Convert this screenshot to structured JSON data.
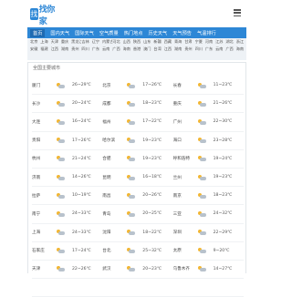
{
  "header": {
    "logo_mark": "找",
    "logo_text": "找你家",
    "menu_icon": "hamburger-icon"
  },
  "nav": {
    "items": [
      "首页",
      "国内天气",
      "国际天气",
      "空气质量",
      "热门地点",
      "历史天气",
      "天气预告",
      "气温排行"
    ]
  },
  "cities": {
    "rows": [
      [
        "北京",
        "上海",
        "天津",
        "重庆",
        "黑龙江",
        "吉林",
        "辽宁",
        "内蒙古",
        "河北",
        "山西",
        "陕西",
        "山东",
        "新疆",
        "西藏",
        "青海",
        "甘肃",
        "宁夏",
        "河南",
        "江苏",
        "湖北",
        "浙江"
      ],
      [
        "安徽",
        "福建",
        "江西",
        "湖南",
        "贵州",
        "四川",
        "广东",
        "云南",
        "广西",
        "海南",
        "香港",
        "澳门",
        "台湾",
        "江西",
        "湖南",
        "贵州",
        "四川",
        "广东",
        "云南",
        "广西",
        "海南"
      ]
    ]
  },
  "panel": {
    "title": "全国主要城市",
    "weather_icon": "partly-cloudy-icon",
    "rows": [
      [
        {
          "city": "厦门",
          "temp": "26~29℃"
        },
        {
          "city": "北京",
          "temp": "17~26℃"
        },
        {
          "city": "长春",
          "temp": "11~23℃"
        }
      ],
      [
        {
          "city": "长沙",
          "temp": "20~24℃"
        },
        {
          "city": "成都",
          "temp": "18~23℃"
        },
        {
          "city": "重庆",
          "temp": "21~26℃"
        }
      ],
      [
        {
          "city": "大连",
          "temp": "16~24℃"
        },
        {
          "city": "福州",
          "temp": "17~22℃"
        },
        {
          "city": "广州",
          "temp": "22~30℃"
        }
      ],
      [
        {
          "city": "贵阳",
          "temp": "17~26℃"
        },
        {
          "city": "哈尔滨",
          "temp": "19~23℃"
        },
        {
          "city": "海口",
          "temp": "23~28℃"
        }
      ],
      [
        {
          "city": "杭州",
          "temp": "21~24℃"
        },
        {
          "city": "合肥",
          "temp": "19~23℃"
        },
        {
          "city": "呼和浩特",
          "temp": "19~24℃"
        }
      ],
      [
        {
          "city": "济南",
          "temp": "14~26℃"
        },
        {
          "city": "昆明",
          "temp": "16~18℃"
        },
        {
          "city": "兰州",
          "temp": "19~23℃"
        }
      ],
      [
        {
          "city": "拉萨",
          "temp": "10~19℃"
        },
        {
          "city": "南昌",
          "temp": "20~26℃"
        },
        {
          "city": "南京",
          "temp": "18~23℃"
        }
      ],
      [
        {
          "city": "南宁",
          "temp": "24~33℃"
        },
        {
          "city": "青岛",
          "temp": "20~25℃"
        },
        {
          "city": "三亚",
          "temp": "24~32℃"
        }
      ],
      [
        {
          "city": "上海",
          "temp": "24~33℃"
        },
        {
          "city": "沈阳",
          "temp": "18~22℃"
        },
        {
          "city": "深圳",
          "temp": "22~29℃"
        }
      ],
      [
        {
          "city": "石家庄",
          "temp": "17~24℃"
        },
        {
          "city": "台北",
          "temp": "25~32℃"
        },
        {
          "city": "太原",
          "temp": "9~20℃"
        }
      ],
      [
        {
          "city": "天津",
          "temp": "22~26℃"
        },
        {
          "city": "武汉",
          "temp": "20~23℃"
        },
        {
          "city": "乌鲁木齐",
          "temp": "14~27℃"
        }
      ],
      [
        {
          "city": "",
          "temp": ""
        },
        {
          "city": "",
          "temp": ""
        },
        {
          "city": "",
          "temp": ""
        }
      ]
    ]
  },
  "colors": {
    "brand": "#2d87d6",
    "nav_active": "#1f6bb2"
  }
}
